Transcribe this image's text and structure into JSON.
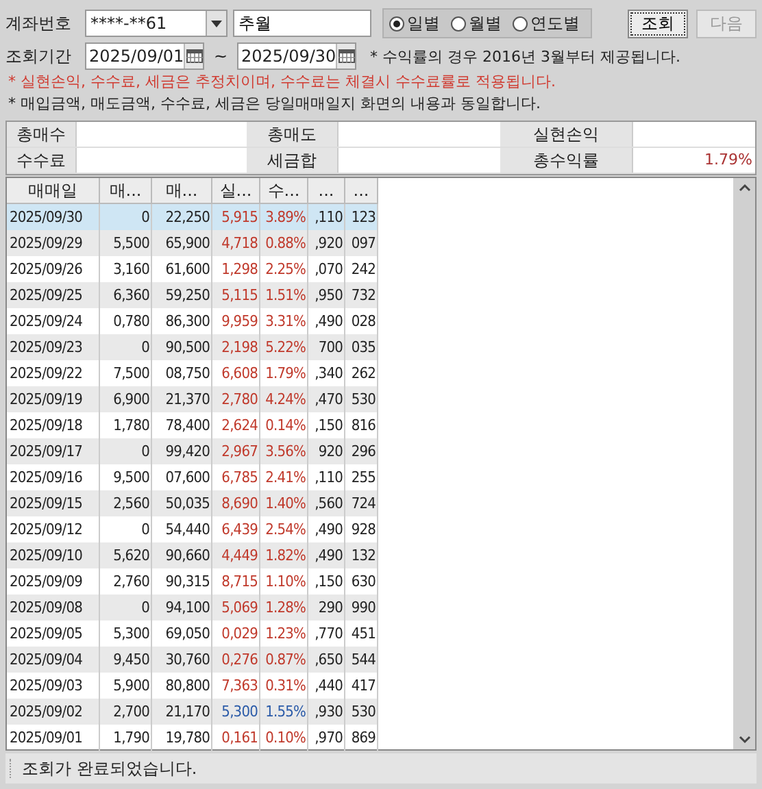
{
  "account": {
    "label": "계좌번호",
    "value": "****-**61",
    "name": "추월"
  },
  "period_options": [
    {
      "label": "일별",
      "selected": true
    },
    {
      "label": "월별",
      "selected": false
    },
    {
      "label": "연도별",
      "selected": false
    }
  ],
  "buttons": [
    {
      "label": "조회",
      "disabled": false
    },
    {
      "label": "다음",
      "disabled": true
    }
  ],
  "period": {
    "label": "조회기간",
    "from": "2025/09/01",
    "separator": "~",
    "to": "2025/09/30",
    "note": "* 수익률의 경우 2016년 3월부터 제공됩니다."
  },
  "notes": [
    {
      "text": "* 실현손익, 수수료, 세금은 추정치이며, 수수료는 체결시 수수료률로 적용됩니다.",
      "kind": "warning"
    },
    {
      "text": "* 매입금액, 매도금액, 수수료, 세금은 당일매매일지 화면의 내용과 동일합니다.",
      "kind": "info"
    }
  ],
  "summary": [
    {
      "label": "총매수"
    },
    {
      "label": "총매도"
    },
    {
      "label": "실현손익"
    },
    {
      "label": "수수료"
    },
    {
      "label": "세금합"
    },
    {
      "label": "총수익률",
      "value": "1.79%"
    }
  ],
  "table": {
    "columns": [
      "매매일",
      "매...",
      "매...",
      "실...",
      "수...",
      "...",
      "..."
    ],
    "rows": [
      {
        "cells": [
          "2025/09/30",
          "0",
          "22,250",
          "5,915",
          "3.89%",
          ",110",
          "123"
        ],
        "kind": "gain",
        "selected": true
      },
      {
        "cells": [
          "2025/09/29",
          "5,500",
          "65,900",
          "4,718",
          "0.88%",
          ",920",
          "097"
        ],
        "kind": "gain",
        "selected": false
      },
      {
        "cells": [
          "2025/09/26",
          "3,160",
          "61,600",
          "1,298",
          "2.25%",
          ",070",
          "242"
        ],
        "kind": "gain",
        "selected": false
      },
      {
        "cells": [
          "2025/09/25",
          "6,360",
          "59,250",
          "5,115",
          "1.51%",
          ",950",
          "732"
        ],
        "kind": "gain",
        "selected": false
      },
      {
        "cells": [
          "2025/09/24",
          "0,780",
          "86,300",
          "9,959",
          "3.31%",
          ",490",
          "028"
        ],
        "kind": "gain",
        "selected": false
      },
      {
        "cells": [
          "2025/09/23",
          "0",
          "90,500",
          "2,198",
          "5.22%",
          "700",
          "035"
        ],
        "kind": "gain",
        "selected": false
      },
      {
        "cells": [
          "2025/09/22",
          "7,500",
          "08,750",
          "6,608",
          "1.79%",
          ",340",
          "262"
        ],
        "kind": "gain",
        "selected": false
      },
      {
        "cells": [
          "2025/09/19",
          "6,900",
          "21,370",
          "2,780",
          "4.24%",
          ",470",
          "530"
        ],
        "kind": "gain",
        "selected": false
      },
      {
        "cells": [
          "2025/09/18",
          "1,780",
          "78,400",
          "2,624",
          "0.14%",
          ",150",
          "816"
        ],
        "kind": "gain",
        "selected": false
      },
      {
        "cells": [
          "2025/09/17",
          "0",
          "99,420",
          "2,967",
          "3.56%",
          "920",
          "296"
        ],
        "kind": "gain",
        "selected": false
      },
      {
        "cells": [
          "2025/09/16",
          "9,500",
          "07,600",
          "6,785",
          "2.41%",
          ",110",
          "255"
        ],
        "kind": "gain",
        "selected": false
      },
      {
        "cells": [
          "2025/09/15",
          "2,560",
          "50,035",
          "8,690",
          "1.40%",
          ",560",
          "724"
        ],
        "kind": "gain",
        "selected": false
      },
      {
        "cells": [
          "2025/09/12",
          "0",
          "54,440",
          "6,439",
          "2.54%",
          ",490",
          "928"
        ],
        "kind": "gain",
        "selected": false
      },
      {
        "cells": [
          "2025/09/10",
          "5,620",
          "90,660",
          "4,449",
          "1.82%",
          ",490",
          "132"
        ],
        "kind": "gain",
        "selected": false
      },
      {
        "cells": [
          "2025/09/09",
          "2,760",
          "90,315",
          "8,715",
          "1.10%",
          ",150",
          "630"
        ],
        "kind": "gain",
        "selected": false
      },
      {
        "cells": [
          "2025/09/08",
          "0",
          "94,100",
          "5,069",
          "1.28%",
          "290",
          "990"
        ],
        "kind": "gain",
        "selected": false
      },
      {
        "cells": [
          "2025/09/05",
          "5,300",
          "69,050",
          "0,029",
          "1.23%",
          ",770",
          "451"
        ],
        "kind": "gain",
        "selected": false
      },
      {
        "cells": [
          "2025/09/04",
          "9,450",
          "30,760",
          "0,276",
          "0.87%",
          ",650",
          "544"
        ],
        "kind": "gain",
        "selected": false
      },
      {
        "cells": [
          "2025/09/03",
          "5,900",
          "80,800",
          "7,363",
          "0.31%",
          ",440",
          "417"
        ],
        "kind": "gain",
        "selected": false
      },
      {
        "cells": [
          "2025/09/02",
          "2,700",
          "21,170",
          "5,300",
          "1.55%",
          ",930",
          "530"
        ],
        "kind": "loss",
        "selected": false
      },
      {
        "cells": [
          "2025/09/01",
          "1,790",
          "19,780",
          "0,161",
          "0.10%",
          ",970",
          "869"
        ],
        "kind": "gain",
        "selected": false
      }
    ]
  },
  "status_bar": "조회가 완료되었습니다."
}
